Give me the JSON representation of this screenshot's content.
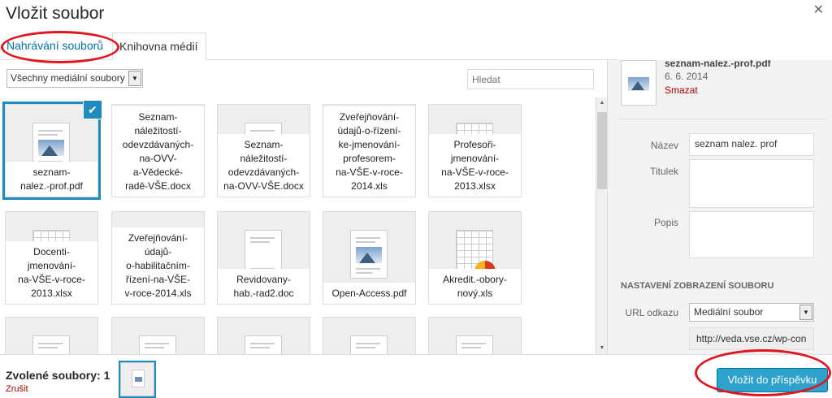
{
  "window": {
    "title": "Vložit soubor",
    "close_icon": "close-icon"
  },
  "tabs": [
    {
      "label": "Nahrávání souborů",
      "active": false
    },
    {
      "label": "Knihovna médií",
      "active": true
    }
  ],
  "toolbar": {
    "filter_value": "Všechny mediální soubory",
    "search_placeholder": "Hledat"
  },
  "grid": {
    "items": [
      {
        "caption": "seznam-\nnalez.-prof.pdf",
        "kind": "pdf",
        "selected": true
      },
      {
        "caption": "Seznam-\nnáležitostí-\nodevzdávaných-\nna-OVV-\na-Vědecké-\nradě-VŠE.docx",
        "kind": "doc",
        "selected": false
      },
      {
        "caption": "Seznam-\nnáležitostí-\nodevzdávaných-\nna-OVV-VŠE.docx",
        "kind": "doc",
        "selected": false
      },
      {
        "caption": "Zveřejňování-\núdajů-o-řízení-\nke-jmenování-\nprofesorem-\nna-VŠE-v-roce-\n2014.xls",
        "kind": "xls",
        "selected": false
      },
      {
        "caption": "Profesoři-\njmenování-\nna-VŠE-v-roce-\n2013.xlsx",
        "kind": "xls",
        "selected": false
      },
      {
        "caption": "Docenti-\njmenování-\nna-VŠE-v-roce-\n2013.xlsx",
        "kind": "xls",
        "selected": false
      },
      {
        "caption": "Zveřejňování-\núdajů-\no-habilitačním-\nřízení-na-VŠE-\nv-roce-2014.xls",
        "kind": "xls",
        "selected": false
      },
      {
        "caption": "Revidovany-\nhab.-rad2.doc",
        "kind": "doc",
        "selected": false
      },
      {
        "caption": "Open-Access.pdf",
        "kind": "pdf",
        "selected": false
      },
      {
        "caption": "Akredit.-obory-\nnový.xls",
        "kind": "xls-pie",
        "selected": false
      },
      {
        "caption": "",
        "kind": "doc",
        "selected": false
      },
      {
        "caption": "",
        "kind": "doc",
        "selected": false
      },
      {
        "caption": "",
        "kind": "doc",
        "selected": false
      },
      {
        "caption": "",
        "kind": "doc",
        "selected": false
      },
      {
        "caption": "",
        "kind": "doc",
        "selected": false
      }
    ]
  },
  "details": {
    "filename": "seznam-nalez.-prof.pdf",
    "date": "6. 6. 2014",
    "delete_label": "Smazat",
    "fields": {
      "title_label": "Název",
      "title_value": "seznam nalez. prof",
      "caption_label": "Titulek",
      "caption_value": "",
      "description_label": "Popis",
      "description_value": ""
    },
    "display_settings_heading": "NASTAVENÍ ZOBRAZENÍ SOUBORU",
    "link_label": "URL odkazu",
    "link_select_value": "Mediální soubor",
    "link_url": "http://veda.vse.cz/wp-con"
  },
  "footer": {
    "selected_label": "Zvolené soubory: 1",
    "clear_label": "Zrušit",
    "insert_label": "Vložit do příspěvku"
  },
  "colors": {
    "accent": "#1e8cbe",
    "button": "#2ea2cc",
    "danger": "#aa0000",
    "annotation": "#e3141d"
  }
}
